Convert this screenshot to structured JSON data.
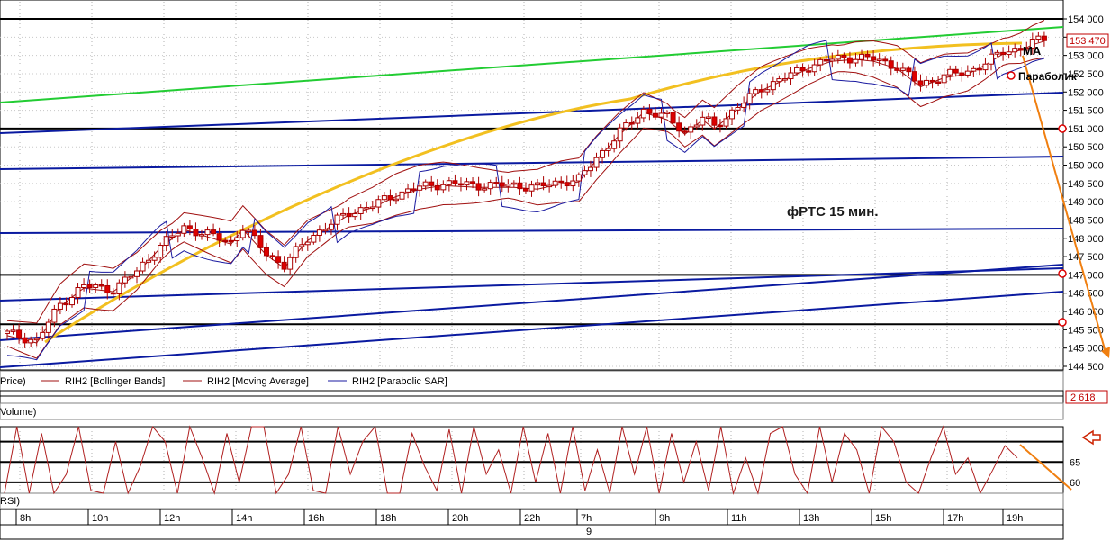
{
  "chart_data": [
    {
      "type": "candlestick",
      "title": "фРТС   15 мин.",
      "y_ticks": [
        144500,
        145000,
        145500,
        146000,
        146500,
        147000,
        147500,
        148000,
        148500,
        149000,
        149500,
        150000,
        150500,
        151000,
        151500,
        152000,
        152500,
        153000,
        153500,
        154000
      ],
      "y_tick_labels": [
        "144 500",
        "145 000",
        "145 500",
        "146 000",
        "146 500",
        "147 000",
        "147 500",
        "148 000",
        "148 500",
        "149 000",
        "149 500",
        "150 000",
        "150 500",
        "151 000",
        "151 500",
        "152 000",
        "152 500",
        "153 000",
        "153 500",
        "154 000"
      ],
      "ylim": [
        144500,
        154200
      ],
      "current_price": 153470,
      "current_price_label": "153 470",
      "x_labels": [
        "8h",
        "10h",
        "12h",
        "14h",
        "16h",
        "18h",
        "20h",
        "22h",
        "7h",
        "9h",
        "11h",
        "13h",
        "15h",
        "17h",
        "19h"
      ],
      "day_marker": "9",
      "candle_close_path": [
        [
          0,
          145400
        ],
        [
          5,
          145200
        ],
        [
          9,
          146200
        ],
        [
          13,
          146700
        ],
        [
          18,
          146600
        ],
        [
          22,
          147100
        ],
        [
          26,
          147800
        ],
        [
          30,
          148300
        ],
        [
          34,
          148100
        ],
        [
          38,
          147900
        ],
        [
          40,
          148300
        ],
        [
          44,
          147600
        ],
        [
          47,
          147250
        ],
        [
          51,
          148000
        ],
        [
          54,
          148300
        ],
        [
          58,
          148700
        ],
        [
          62,
          148900
        ],
        [
          66,
          149200
        ],
        [
          70,
          149400
        ],
        [
          74,
          149500
        ],
        [
          80,
          149450
        ],
        [
          86,
          149450
        ],
        [
          90,
          149400
        ],
        [
          94,
          149550
        ],
        [
          97,
          149600
        ],
        [
          100,
          150200
        ],
        [
          104,
          150900
        ],
        [
          108,
          151500
        ],
        [
          112,
          151300
        ],
        [
          115,
          150900
        ],
        [
          118,
          151300
        ],
        [
          120,
          151050
        ],
        [
          124,
          151600
        ],
        [
          128,
          152100
        ],
        [
          132,
          152400
        ],
        [
          136,
          152700
        ],
        [
          140,
          152900
        ],
        [
          144,
          152950
        ],
        [
          147,
          152900
        ],
        [
          151,
          152700
        ],
        [
          155,
          152200
        ],
        [
          159,
          152450
        ],
        [
          163,
          152550
        ],
        [
          166,
          152800
        ],
        [
          169,
          153100
        ],
        [
          172,
          153200
        ],
        [
          174,
          153350
        ],
        [
          176,
          153450
        ]
      ],
      "series": [
        {
          "name": "RIH2 [Bollinger Bands]"
        },
        {
          "name": "RIH2 [Moving Average]"
        },
        {
          "name": "RIH2 [Parabolic SAR]"
        }
      ],
      "legend_left_fragment": "Price)",
      "horizontal_levels": [
        154000,
        151000,
        147000,
        145650
      ],
      "annotations": [
        "MA",
        "Параболик"
      ]
    },
    {
      "type": "bar",
      "name": "Volume",
      "label": "Volume)",
      "last_value_label": "2 618"
    },
    {
      "type": "line",
      "name": "RSI",
      "label": "RSI)",
      "y_ticks": [
        60,
        65
      ],
      "levels": [
        70,
        65,
        60
      ],
      "ylim": [
        58,
        73
      ],
      "values": [
        55,
        74,
        42,
        72,
        48,
        62,
        75,
        58,
        46,
        70,
        52,
        64,
        76,
        70,
        48,
        75,
        66,
        56,
        72,
        60,
        76,
        74,
        50,
        62,
        76,
        58,
        52,
        76,
        62,
        70,
        78,
        54,
        44,
        72,
        64,
        58,
        73,
        50,
        76,
        62,
        68,
        46,
        74,
        60,
        72,
        48,
        76,
        58,
        68,
        52,
        74,
        62,
        76,
        44,
        72,
        60,
        70,
        58,
        76,
        50,
        66,
        54,
        72,
        76,
        62,
        48,
        74,
        60,
        72,
        68,
        56,
        76,
        70,
        60,
        50,
        66,
        74,
        62,
        66,
        55,
        63,
        69,
        66
      ]
    }
  ]
}
